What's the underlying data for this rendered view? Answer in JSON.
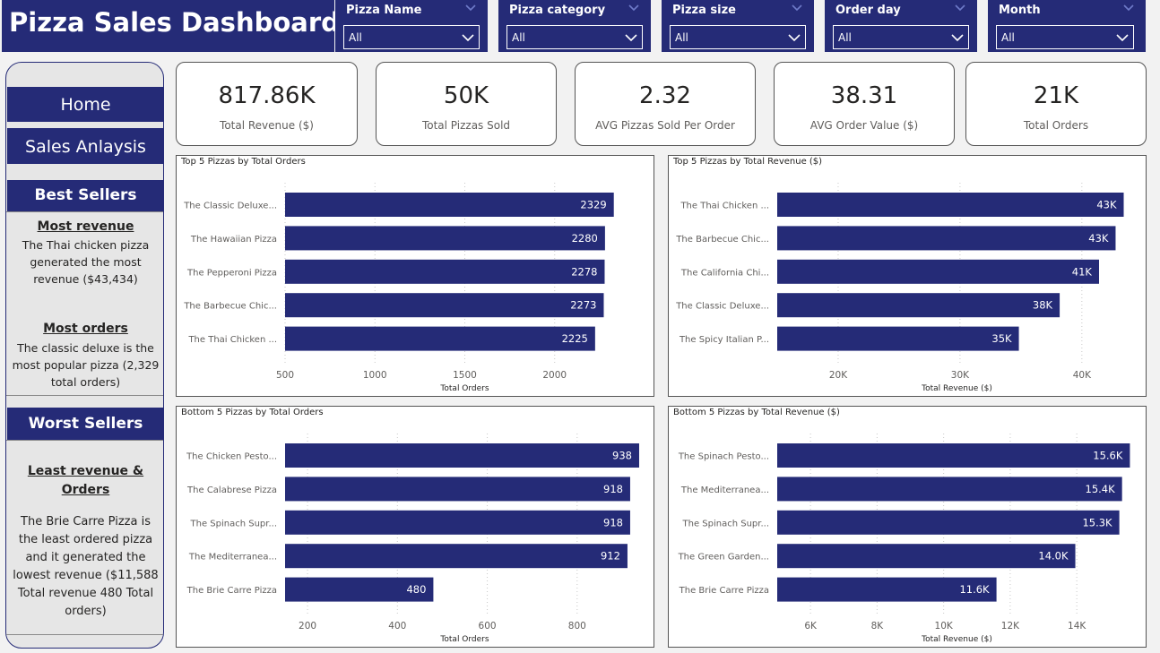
{
  "header": {
    "title": "Pizza Sales Dashboard"
  },
  "filters": [
    {
      "label": "Pizza Name",
      "value": "All"
    },
    {
      "label": "Pizza category",
      "value": "All"
    },
    {
      "label": "Pizza size",
      "value": "All"
    },
    {
      "label": "Order day",
      "value": "All"
    },
    {
      "label": "Month",
      "value": "All"
    }
  ],
  "sidebar": {
    "home_label": "Home",
    "sales_label": "Sales Anlaysis",
    "best_header": "Best Sellers",
    "most_revenue_heading": "Most revenue",
    "most_revenue_text": "The Thai chicken pizza generated the most revenue ($43,434)",
    "most_orders_heading": "Most orders",
    "most_orders_text": "The classic deluxe is the most popular pizza (2,329 total orders)",
    "worst_header": "Worst Sellers",
    "least_heading": "Least revenue & Orders",
    "least_text": "The Brie Carre Pizza is the least ordered pizza and it generated the lowest revenue ($11,588 Total revenue 480 Total orders)"
  },
  "kpis": [
    {
      "value": "817.86K",
      "label": "Total Revenue ($)"
    },
    {
      "value": "50K",
      "label": "Total Pizzas Sold"
    },
    {
      "value": "2.32",
      "label": "AVG Pizzas Sold Per Order"
    },
    {
      "value": "38.31",
      "label": "AVG Order Value ($)"
    },
    {
      "value": "21K",
      "label": "Total Orders"
    }
  ],
  "colors": {
    "navy": "#252b77",
    "panel": "#e6e6e6"
  },
  "chart_data": [
    {
      "type": "bar",
      "title": "Top 5 Pizzas by Total Orders",
      "xlabel": "Total Orders",
      "categories": [
        "The Classic Deluxe...",
        "The Hawaiian Pizza",
        "The Pepperoni Pizza",
        "The Barbecue Chic...",
        "The Thai Chicken ..."
      ],
      "values": [
        2329,
        2280,
        2278,
        2273,
        2225
      ],
      "labels": [
        "2329",
        "2280",
        "2278",
        "2273",
        "2225"
      ],
      "xlim": [
        500,
        2500
      ],
      "ticks": [
        500,
        1000,
        1500,
        2000
      ],
      "tick_labels": [
        "500",
        "1000",
        "1500",
        "2000"
      ]
    },
    {
      "type": "bar",
      "title": "Top 5 Pizzas by Total Revenue ($)",
      "xlabel": "Total Revenue ($)",
      "categories": [
        "The Thai Chicken ...",
        "The Barbecue Chic...",
        "The California Chi...",
        "The Classic Deluxe...",
        "The Spicy Italian P..."
      ],
      "values": [
        43434,
        42768,
        41410,
        38180,
        34831
      ],
      "labels": [
        "43K",
        "43K",
        "41K",
        "38K",
        "35K"
      ],
      "xlim": [
        15000,
        44500
      ],
      "ticks": [
        20000,
        30000,
        40000
      ],
      "tick_labels": [
        "20K",
        "30K",
        "40K"
      ]
    },
    {
      "type": "bar",
      "title": "Bottom 5 Pizzas by Total Orders",
      "xlabel": "Total Orders",
      "categories": [
        "The Chicken Pesto...",
        "The Calabrese Pizza",
        "The Spinach Supr...",
        "The Mediterranea...",
        "The Brie Carre Pizza"
      ],
      "values": [
        938,
        918,
        918,
        912,
        480
      ],
      "labels": [
        "938",
        "918",
        "918",
        "912",
        "480"
      ],
      "xlim": [
        150,
        950
      ],
      "ticks": [
        200,
        400,
        600,
        800
      ],
      "tick_labels": [
        "200",
        "400",
        "600",
        "800"
      ]
    },
    {
      "type": "bar",
      "title": "Bottom 5 Pizzas by Total Revenue ($)",
      "xlabel": "Total Revenue ($)",
      "categories": [
        "The Spinach Pesto...",
        "The Mediterranea...",
        "The Spinach Supr...",
        "The Green Garden...",
        "The Brie Carre Pizza"
      ],
      "values": [
        15596,
        15360,
        15278,
        13956,
        11588
      ],
      "labels": [
        "15.6K",
        "15.4K",
        "15.3K",
        "14.0K",
        "11.6K"
      ],
      "xlim": [
        5000,
        15800
      ],
      "ticks": [
        6000,
        8000,
        10000,
        12000,
        14000
      ],
      "tick_labels": [
        "6K",
        "8K",
        "10K",
        "12K",
        "14K"
      ]
    }
  ]
}
